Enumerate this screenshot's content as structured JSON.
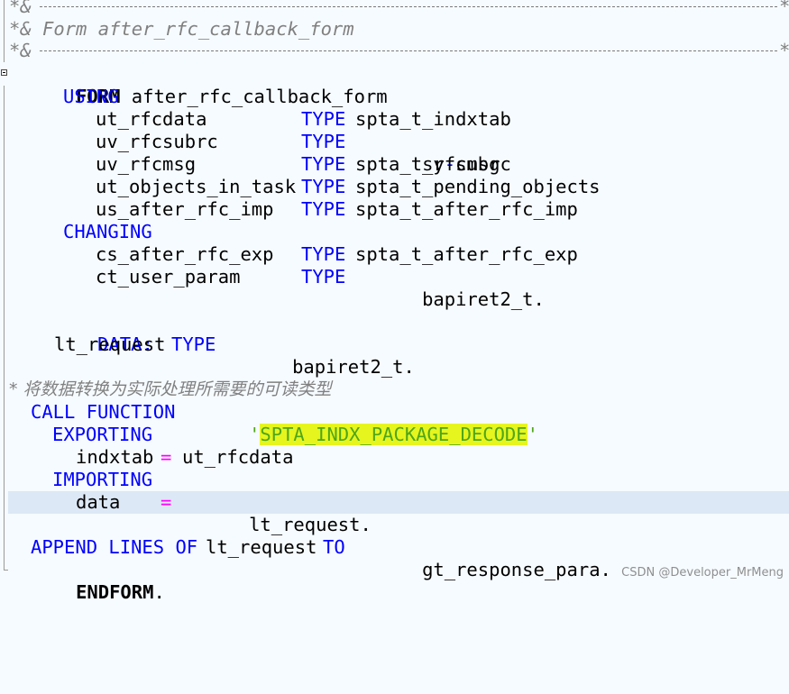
{
  "editor": {
    "comment_header": {
      "rule_top_start": "*&",
      "rule_top_end": "*",
      "title": "*& Form after_rfc_callback_form",
      "rule_bottom_start": "*&",
      "rule_bottom_end": "*"
    },
    "lines": {
      "form": {
        "kw": "FORM",
        "name": " after_rfc_callback_form"
      },
      "using": "USING",
      "p1": {
        "name": "ut_rfcdata",
        "type_kw": "TYPE",
        "type": "spta_t_indxtab"
      },
      "p2": {
        "name": "uv_rfcsubrc",
        "type_kw": "TYPE",
        "type": "sy",
        "type_sep": "-",
        "type_tail": "subrc"
      },
      "p3": {
        "name": "uv_rfcmsg",
        "type_kw": "TYPE",
        "type": "spta_t_rfcmsg"
      },
      "p4": {
        "name": "ut_objects_in_task",
        "type_kw": "TYPE",
        "type": "spta_t_pending_objects"
      },
      "p5": {
        "name": "us_after_rfc_imp",
        "type_kw": "TYPE",
        "type": "spta_t_after_rfc_imp"
      },
      "changing": "CHANGING",
      "p6": {
        "name": "cs_after_rfc_exp",
        "type_kw": "TYPE",
        "type": "spta_t_after_rfc_exp"
      },
      "p7": {
        "name": "ct_user_param",
        "type_kw": "TYPE",
        "type": "bapiret2_t",
        "end": "."
      },
      "data_kw": "DATA",
      "data_colon": ":",
      "decl": {
        "name": "lt_request",
        "type_kw": "TYPE",
        "type": "bapiret2_t",
        "end": "."
      },
      "chinese_comment": "* 将数据转换为实际处理所需要的可读类型",
      "call": {
        "kw": "CALL FUNCTION",
        "q1": "'",
        "fname": "SPTA_INDX_PACKAGE_DECODE",
        "q2": "'"
      },
      "exporting": "EXPORTING",
      "exp1": {
        "name": "indxtab",
        "op": "=",
        "value": "ut_rfcdata"
      },
      "importing": "IMPORTING",
      "imp1": {
        "name": "data",
        "op": "=",
        "value": "lt_request",
        "end": "."
      },
      "append": {
        "kw1": "APPEND LINES OF",
        "src": "lt_request",
        "kw2": "TO",
        "dst": "gt_response_para",
        "end": "."
      },
      "endform": {
        "kw": "ENDFORM",
        "end": "."
      }
    }
  },
  "watermark": "CSDN @Developer_MrMeng",
  "colors": {
    "background": "#f6fbff",
    "keyword": "#0000ff",
    "comment": "#808080",
    "string": "#4da619",
    "highlight": "#e6f51e",
    "current_line": "#dde8f6"
  }
}
